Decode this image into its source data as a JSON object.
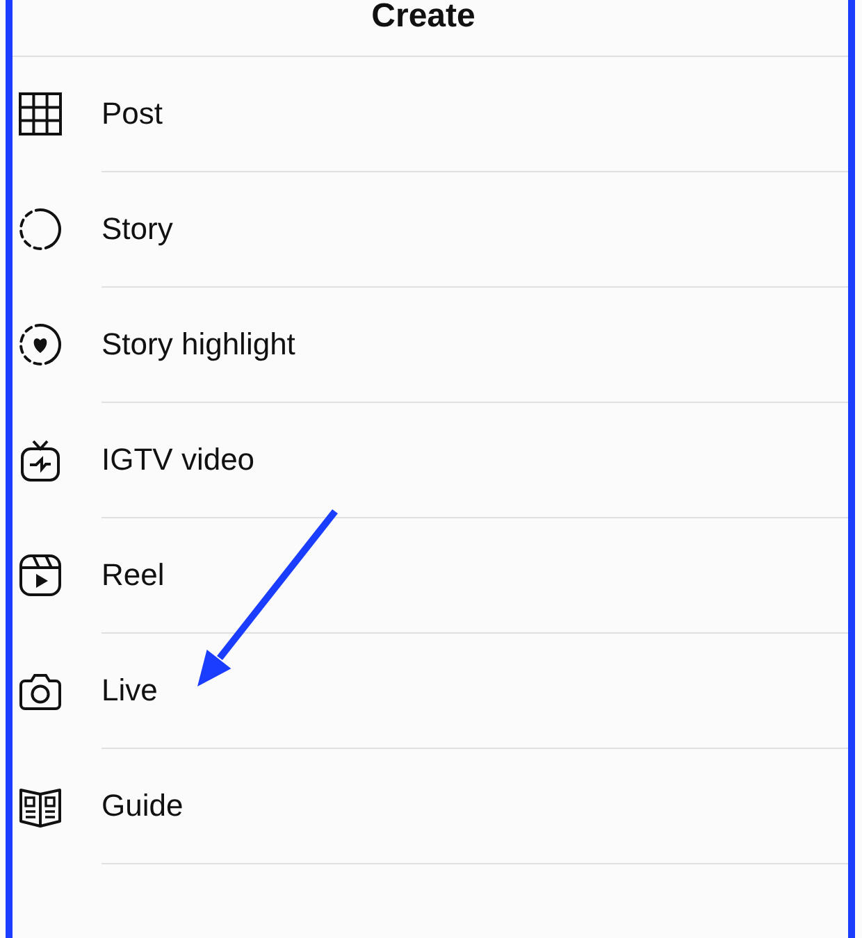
{
  "header": {
    "title": "Create"
  },
  "items": [
    {
      "kind": "post",
      "label": "Post",
      "marked": false
    },
    {
      "kind": "story",
      "label": "Story",
      "marked": false
    },
    {
      "kind": "highlight",
      "label": "Story highlight",
      "marked": false
    },
    {
      "kind": "igtv",
      "label": "IGTV video",
      "marked": false
    },
    {
      "kind": "reel",
      "label": "Reel",
      "marked": false
    },
    {
      "kind": "live",
      "label": "Live",
      "marked": true
    },
    {
      "kind": "guide",
      "label": "Guide",
      "marked": false
    }
  ]
}
